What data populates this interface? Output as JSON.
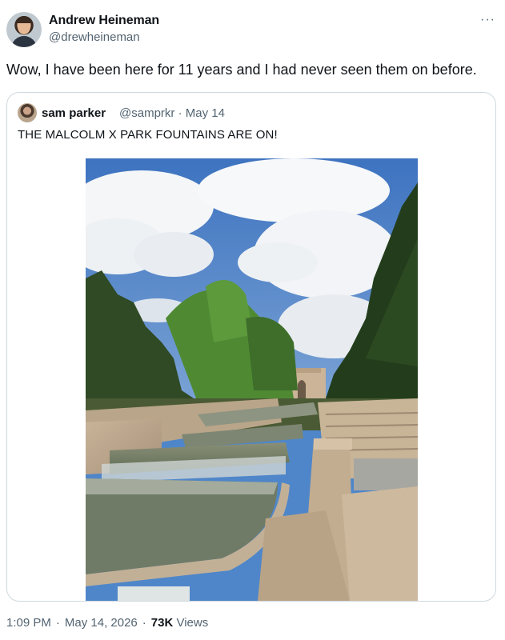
{
  "tweet": {
    "author": {
      "name": "Andrew Heineman",
      "handle": "@drewheineman"
    },
    "more_icon": "more-dots-icon",
    "text": "Wow, I have been here for 11 years and I had never seen them on before.",
    "quote": {
      "author": {
        "name": "sam parker",
        "handle": "@samprkr"
      },
      "date": "May 14",
      "meta_sep": "·",
      "text": "THE MALCOLM X PARK FOUNTAINS ARE ON!"
    },
    "footer": {
      "time": "1:09 PM",
      "date": "May 14, 2026",
      "views_count": "73K",
      "views_label": "Views",
      "sep": "·"
    }
  },
  "colors": {
    "text_primary": "#0f1419",
    "text_secondary": "#536471",
    "border": "#cfd9de"
  }
}
